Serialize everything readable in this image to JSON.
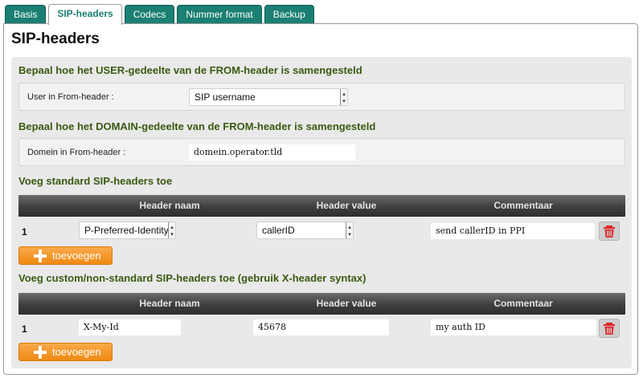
{
  "tabs": [
    {
      "label": "Basis"
    },
    {
      "label": "SIP-headers",
      "active": true
    },
    {
      "label": "Codecs"
    },
    {
      "label": "Nummer format"
    },
    {
      "label": "Backup"
    }
  ],
  "page": {
    "title": "SIP-headers"
  },
  "from_user": {
    "title": "Bepaal hoe het USER-gedeelte van de FROM-header is samengesteld",
    "label": "User in From-header :",
    "value": "SIP username"
  },
  "from_domain": {
    "title": "Bepaal hoe het DOMAIN-gedeelte van de FROM-header is samengesteld",
    "label": "Domein in From-header :",
    "value": "domein.operator.tld"
  },
  "standard": {
    "title": "Voeg standard SIP-headers toe",
    "columns": [
      "Header naam",
      "Header value",
      "Commentaar"
    ],
    "rows": [
      {
        "num": "1",
        "header_name": "P-Preferred-Identity",
        "header_value": "callerID",
        "comment": "send callerID in PPI"
      }
    ],
    "add_label": "toevoegen"
  },
  "custom": {
    "title": "Voeg custom/non-standard SIP-headers toe (gebruik X-header syntax)",
    "columns": [
      "Header naam",
      "Header value",
      "Commentaar"
    ],
    "rows": [
      {
        "num": "1",
        "header_name": "X-My-Id",
        "header_value": "45678",
        "comment": "my auth ID"
      }
    ],
    "add_label": "toevoegen"
  },
  "colors": {
    "tab": "#1b7f74",
    "section_title": "#3a5a12",
    "add_button": "#f39a2e",
    "delete_icon": "#e0262a"
  },
  "icons": {
    "add": "plus-icon",
    "delete": "trash-icon",
    "select": "dropdown-arrow-icon"
  }
}
